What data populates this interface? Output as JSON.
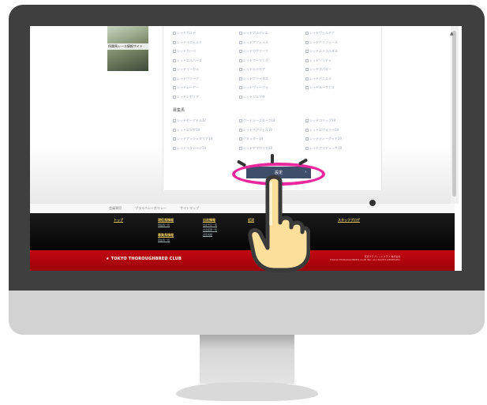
{
  "sidebar": {
    "thumb_label": "所属馬レース情報サイト"
  },
  "options": {
    "col1": [
      "レッドガルデ",
      "レッドラジェルド",
      "レッドカーペ",
      "レッドエルハーズ",
      "レッドリーガル",
      "レッドヴァーク",
      "レッドムーヤー",
      "レッドレガリア"
    ],
    "col2": [
      "レッドアルディエ",
      "レッドアフェイル",
      "レッドガヴァーナ",
      "レッドクーリング",
      "レッドエルモア",
      "レッドファイタス",
      "レッドヴィーヴォ",
      "レッドジルクタ"
    ],
    "col3": [
      "レッドヴェルチナ",
      "レッドクリジェール",
      "レッドエメラルダス",
      "レッドソリチャ",
      "レッドスパダー",
      "レッドボニエル",
      "レッドルーファス"
    ]
  },
  "section": {
    "heading": "募集馬",
    "col1": [
      "レッドゼーアドル17",
      "レッドエンゲ19",
      "レッドアッシュタリア19",
      "レッドリグレージ19"
    ],
    "col2": [
      "ゲートシーズターフ18",
      "レッドベアジェル19",
      "ゲキュター19",
      "レッドアマポリカ19"
    ],
    "col3": [
      "レッドコリップ19",
      "レッドエヴォリー19",
      "レッドティーグッチ19",
      "レッドアマチュッサ19"
    ]
  },
  "submit_button": {
    "label": "設定",
    "arrow": "›"
  },
  "footer": {
    "links": [
      "会員専用",
      "プライバシーポリシー",
      "サイトマップ"
    ],
    "columns": [
      {
        "title": "トップ",
        "subs": []
      },
      {
        "title": "現役馬情報",
        "subs": [
          "現役馬一覧"
        ]
      },
      {
        "title": "出走情報",
        "subs": [
          "出走予定一覧",
          "出走結果一覧",
          "競走成績"
        ]
      },
      {
        "title": "近況",
        "subs": []
      },
      {
        "title": "スタッフブログ",
        "subs": []
      }
    ],
    "col2_extra_title": "募集馬情報",
    "col2_extra_sub": "募集馬一覧",
    "brand": "TOKYO THOROUGHBRED CLUB",
    "brand_star": "★",
    "copyright_1": "東京サラブレッドクラブ 株式会社",
    "copyright_2": "TOKYO THOROUGHBRED CLUB INC. ALL RIGHTS RESERVED."
  },
  "colors": {
    "highlight": "#e8289c",
    "footer_red": "#c20812",
    "button": "#3f4e6b",
    "hand": "#fbdf9a"
  }
}
